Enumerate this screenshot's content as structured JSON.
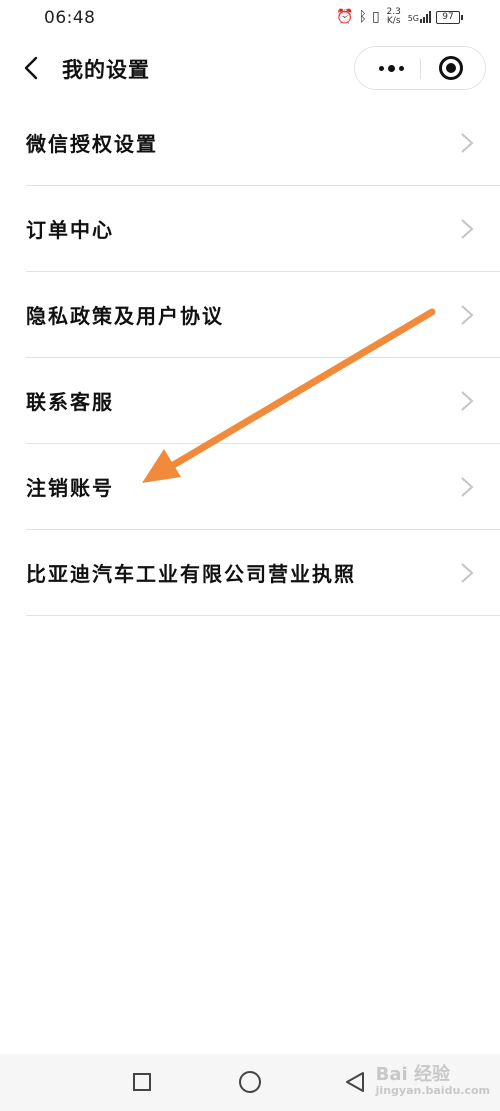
{
  "status_bar": {
    "time": "06:48",
    "net_speed": "2.3",
    "net_speed_unit": "K/s",
    "network": "5G",
    "battery": "97"
  },
  "header": {
    "title": "我的设置",
    "back_icon": "chevron-left-icon",
    "more_icon": "more-dots-icon",
    "close_icon": "target-circle-icon"
  },
  "menu": {
    "items": [
      {
        "label": "微信授权设置"
      },
      {
        "label": "订单中心"
      },
      {
        "label": "隐私政策及用户协议"
      },
      {
        "label": "联系客服"
      },
      {
        "label": "注销账号"
      },
      {
        "label": "比亚迪汽车工业有限公司营业执照"
      }
    ],
    "chevron_color": "#c4c4c4"
  },
  "annotation": {
    "arrow_color": "#f28a3c",
    "target_item": "注销账号"
  },
  "system_nav": {
    "buttons": [
      "recent-apps-icon",
      "home-icon",
      "back-triangle-icon"
    ]
  },
  "watermark": {
    "text": "Bai 经验",
    "sub": "jingyan.baidu.com"
  }
}
